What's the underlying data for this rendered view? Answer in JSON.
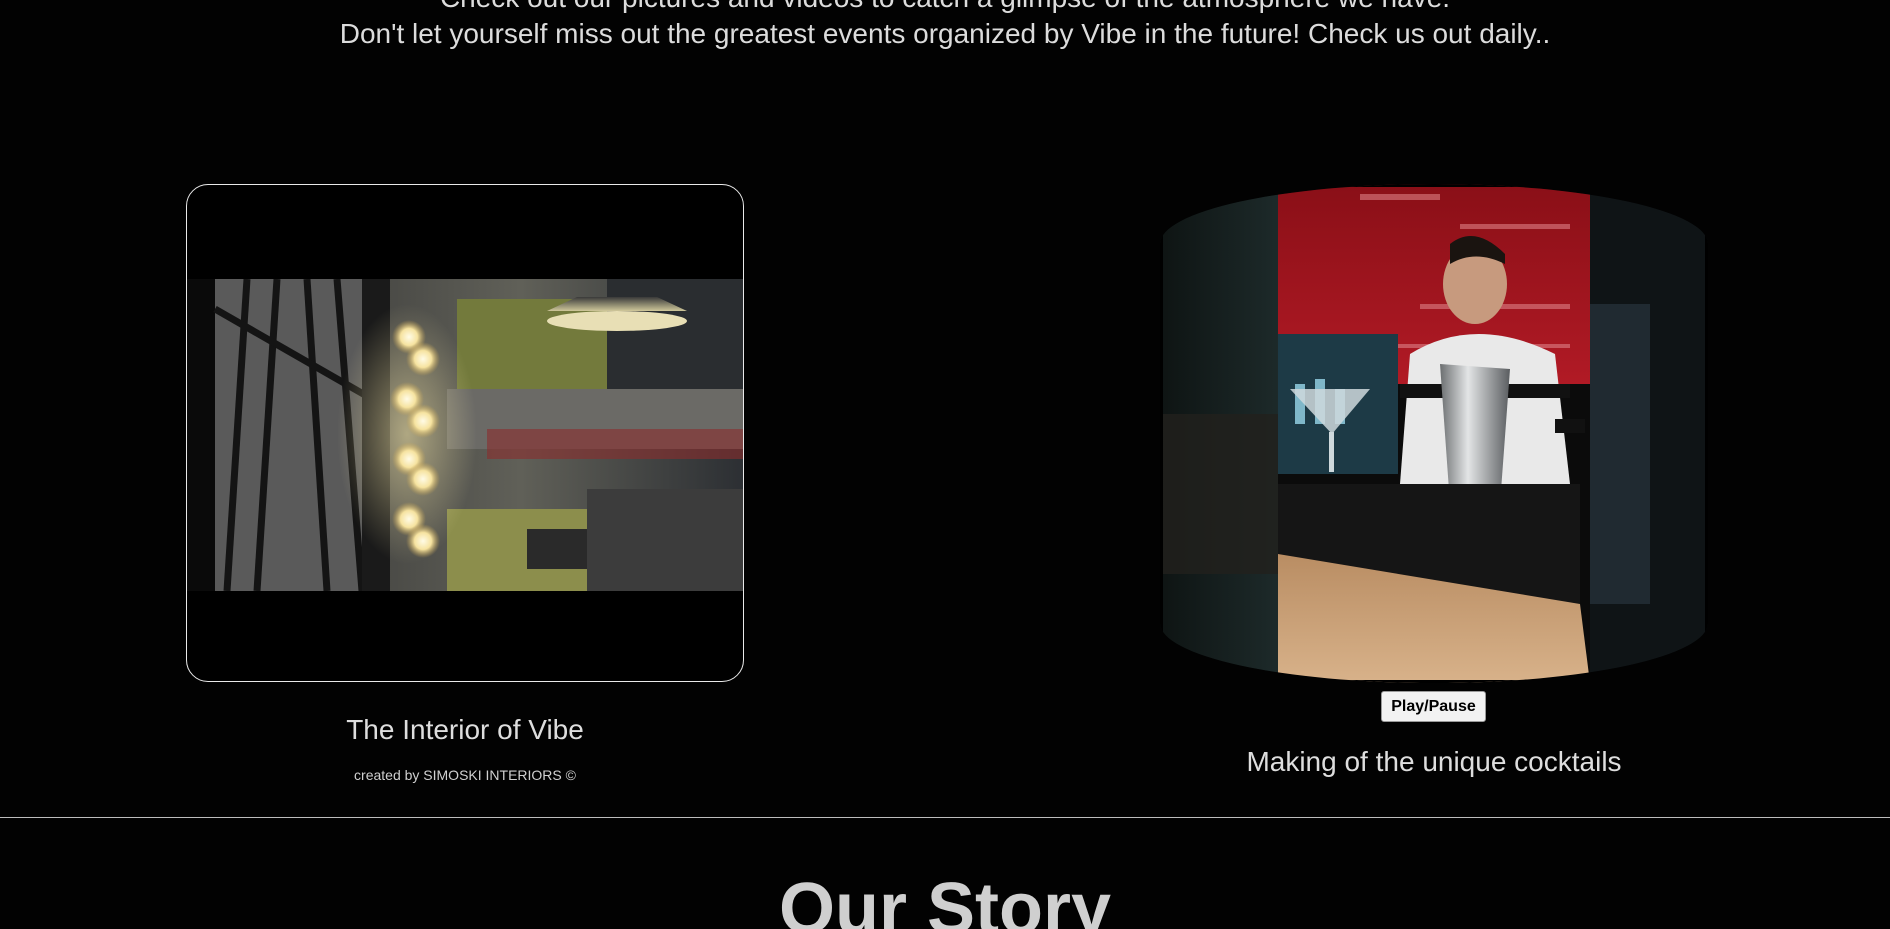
{
  "intro": {
    "line1": "Check out our pictures and videos to catch a glimpse of the atmosphere we have.",
    "line2": "Don't let yourself miss out the greatest events organized by Vibe in the future! Check us out daily.."
  },
  "interior": {
    "title": "The Interior of Vibe",
    "credit": "created by SIMOSKI INTERIORS ©"
  },
  "video": {
    "play_pause_label": "Play/Pause",
    "caption": "Making of the unique cocktails"
  },
  "story": {
    "title": "Our Story"
  },
  "colors": {
    "background": "#020202",
    "text": "#dcdcdc",
    "card_border": "#e9e9e9"
  }
}
